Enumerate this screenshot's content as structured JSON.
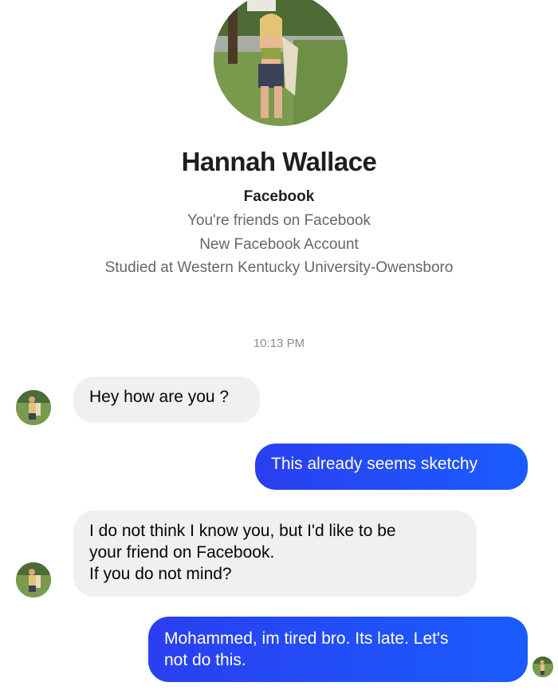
{
  "profile": {
    "name": "Hannah Wallace",
    "source": "Facebook",
    "friends_text": "You're friends on Facebook",
    "account_text": "New Facebook Account",
    "education_text": "Studied at Western Kentucky University-Owensboro"
  },
  "conversation": {
    "timestamp": "10:13 PM",
    "messages": [
      {
        "direction": "incoming",
        "text": "Hey how are you ?"
      },
      {
        "direction": "outgoing",
        "text": "This already seems sketchy"
      },
      {
        "direction": "incoming",
        "text": "I do not think I know you, but I'd like to be\nyour friend on Facebook.\nIf you do not mind?"
      },
      {
        "direction": "outgoing",
        "text": "Mohammed, im tired bro. Its late. Let's\nnot do this."
      }
    ]
  },
  "colors": {
    "outgoing_bubble": "#1a5cff",
    "incoming_bubble": "#f0f0f0",
    "meta_text": "#65676b"
  },
  "icons": {
    "profile_photo": "profile-photo-icon",
    "contact_avatar": "contact-avatar-icon",
    "seen_indicator": "seen-avatar-icon"
  }
}
